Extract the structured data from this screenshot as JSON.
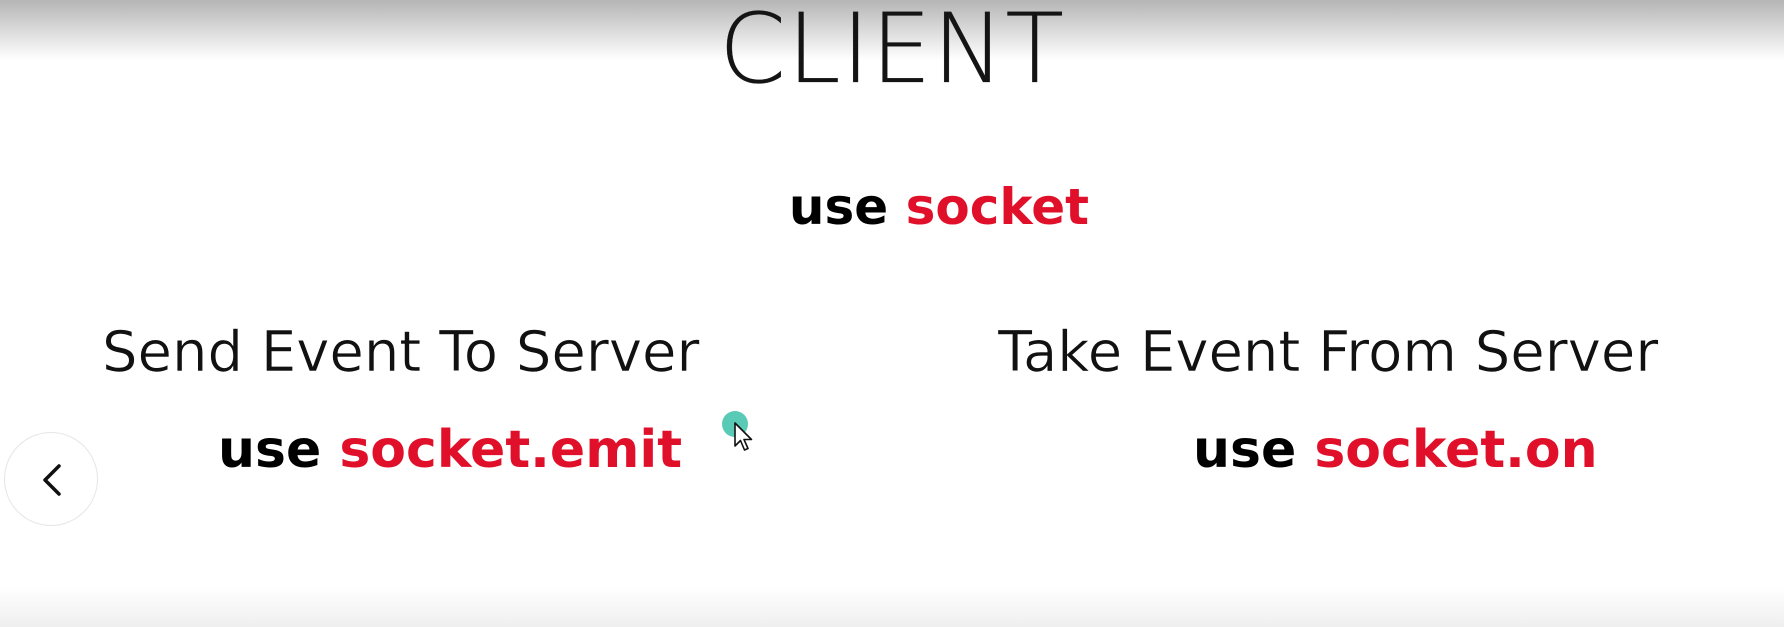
{
  "slide": {
    "title": "CLIENT",
    "center": {
      "keyword": "use",
      "function": "socket"
    },
    "left": {
      "heading": "Send Event To Server",
      "keyword": "use",
      "function": "socket.emit"
    },
    "right": {
      "heading": "Take Event From Server",
      "keyword": "use",
      "function": "socket.on"
    }
  },
  "controls": {
    "back_icon": "chevron-left-icon"
  },
  "overlay": {
    "cursor_icon": "mouse-pointer-icon",
    "click_indicator": "click-ripple"
  },
  "colors": {
    "keyword": "#000000",
    "function": "#e0102a",
    "click_indicator": "#3cc1a8"
  }
}
